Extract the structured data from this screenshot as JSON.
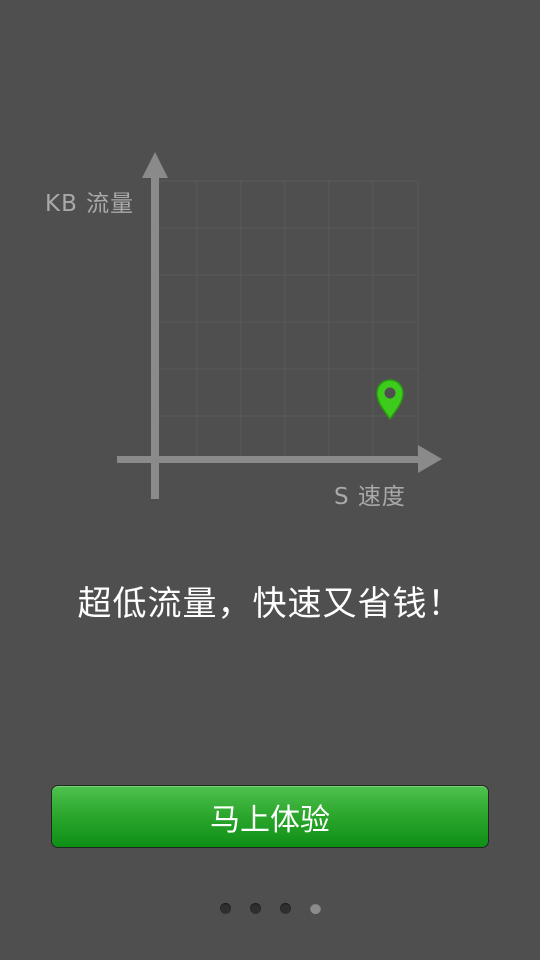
{
  "diagram": {
    "y_axis_label": "KB 流量",
    "x_axis_label": "S 速度",
    "marker_icon": "map-pin-icon",
    "marker_color": "#3dcc1c"
  },
  "tagline": "超低流量，快速又省钱！",
  "cta_button_label": "马上体验",
  "pager": {
    "page_count": 4,
    "current_page": 4
  },
  "colors": {
    "background": "#4f4f4f",
    "axis": "#8a8a8a",
    "button_green": "#2ea82e"
  }
}
